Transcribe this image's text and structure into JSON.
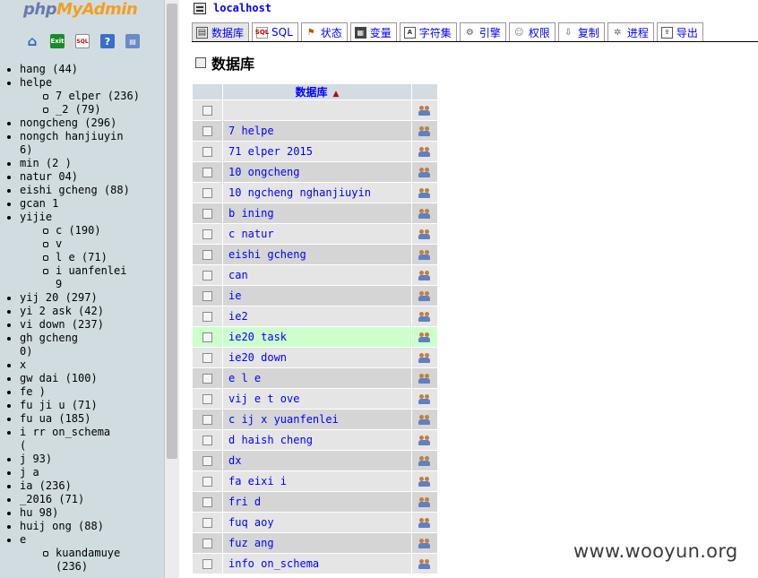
{
  "app": {
    "logo": {
      "php": "php",
      "my": "My",
      "admin": "Admin"
    },
    "nav_icons": [
      "home-icon",
      "exit-icon",
      "sql-query-icon",
      "help-icon",
      "documentation-icon"
    ],
    "nav_icon_glyphs": {
      "home": "⌂",
      "exit": "Exit",
      "sql": "SQL",
      "help": "?",
      "doc": "▤"
    }
  },
  "sidebar": {
    "databases": [
      {
        "label": "hang   (44)",
        "level": 0
      },
      {
        "label": "helpe",
        "level": 0
      },
      {
        "label": "7 elper (236)",
        "level": 1
      },
      {
        "label": "_2  (79)",
        "level": 1
      },
      {
        "label": "nongcheng (296)",
        "level": 0
      },
      {
        "label": "nongch   hanjiuyin",
        "level": 0
      },
      {
        "label": "6)",
        "level": 0,
        "continuation": true
      },
      {
        "label": "min  (2  )",
        "level": 0
      },
      {
        "label": "natur   04)",
        "level": 0
      },
      {
        "label": "eishi  gcheng (88)",
        "level": 0
      },
      {
        "label": "gcan  1",
        "level": 0
      },
      {
        "label": "yijie",
        "level": 0
      },
      {
        "label": "c    (190)",
        "level": 1
      },
      {
        "label": "v",
        "level": 1
      },
      {
        "label": "l e (71)",
        "level": 1
      },
      {
        "label": "i uanfenlei",
        "level": 1
      },
      {
        "label": "9",
        "level": 1,
        "continuation": true
      },
      {
        "label": "yij 20  (297)",
        "level": 0
      },
      {
        "label": "yi  2  ask (42)",
        "level": 0
      },
      {
        "label": "vi   down (237)",
        "level": 0
      },
      {
        "label": "gh   gcheng",
        "level": 0
      },
      {
        "label": "0)",
        "level": 0,
        "continuation": true
      },
      {
        "label": "x",
        "level": 0
      },
      {
        "label": "gw   dai (100)",
        "level": 0
      },
      {
        "label": "fe   )",
        "level": 0
      },
      {
        "label": "fu  ji   u (71)",
        "level": 0
      },
      {
        "label": "fu  ua   (185)",
        "level": 0
      },
      {
        "label": "i   rr   on_schema",
        "level": 0
      },
      {
        "label": "(",
        "level": 0,
        "continuation": true
      },
      {
        "label": "j   93)",
        "level": 0
      },
      {
        "label": "j    a",
        "level": 0
      },
      {
        "label": "  ia (236)",
        "level": 0
      },
      {
        "label": "   _2016 (71)",
        "level": 0
      },
      {
        "label": "hu  98)",
        "level": 0
      },
      {
        "label": "huij  ong (88)",
        "level": 0
      },
      {
        "label": "e",
        "level": 0
      },
      {
        "label": "kuandamuye",
        "level": 1
      },
      {
        "label": "(236)",
        "level": 1,
        "continuation": true
      }
    ]
  },
  "server": {
    "name": "localhost"
  },
  "tabs": [
    {
      "label": "数据库",
      "icon": "database-icon",
      "glyph": "▤",
      "active": true
    },
    {
      "label": "SQL",
      "icon": "sql-icon",
      "glyph": "SQL",
      "active": false
    },
    {
      "label": "状态",
      "icon": "status-icon",
      "glyph": "⚑",
      "active": false
    },
    {
      "label": "变量",
      "icon": "variables-icon",
      "glyph": "▦",
      "active": false
    },
    {
      "label": "字符集",
      "icon": "charset-icon",
      "glyph": "A",
      "active": false
    },
    {
      "label": "引擎",
      "icon": "engine-icon",
      "glyph": "⚙",
      "active": false
    },
    {
      "label": "权限",
      "icon": "privileges-icon",
      "glyph": "☺",
      "active": false
    },
    {
      "label": "复制",
      "icon": "replication-icon",
      "glyph": "⇩",
      "active": false
    },
    {
      "label": "进程",
      "icon": "processes-icon",
      "glyph": "✲",
      "active": false
    },
    {
      "label": "导出",
      "icon": "export-icon",
      "glyph": "⇪",
      "active": false
    }
  ],
  "main": {
    "title": "数据库",
    "table": {
      "header": "数据库",
      "sort_indicator": "▲",
      "highlighted_index": 11,
      "rows": [
        "  ",
        "7 helpe ",
        "71 elper 2015",
        "10 ongcheng",
        "10 ngcheng  nghanjiuyin",
        "b ining",
        "c natur",
        " eishi gcheng",
        "  can",
        "  ie",
        "  ie2",
        "  ie20 task",
        "  ie20 down",
        " e l e",
        " vij e t ove",
        "c ij x  yuanfenlei",
        "d haish  cheng",
        "dx",
        "fa eixi i",
        "fri d",
        "fuq  aoy",
        "fuz ang",
        "info   on_schema"
      ]
    }
  },
  "watermark": "www.wooyun.org"
}
